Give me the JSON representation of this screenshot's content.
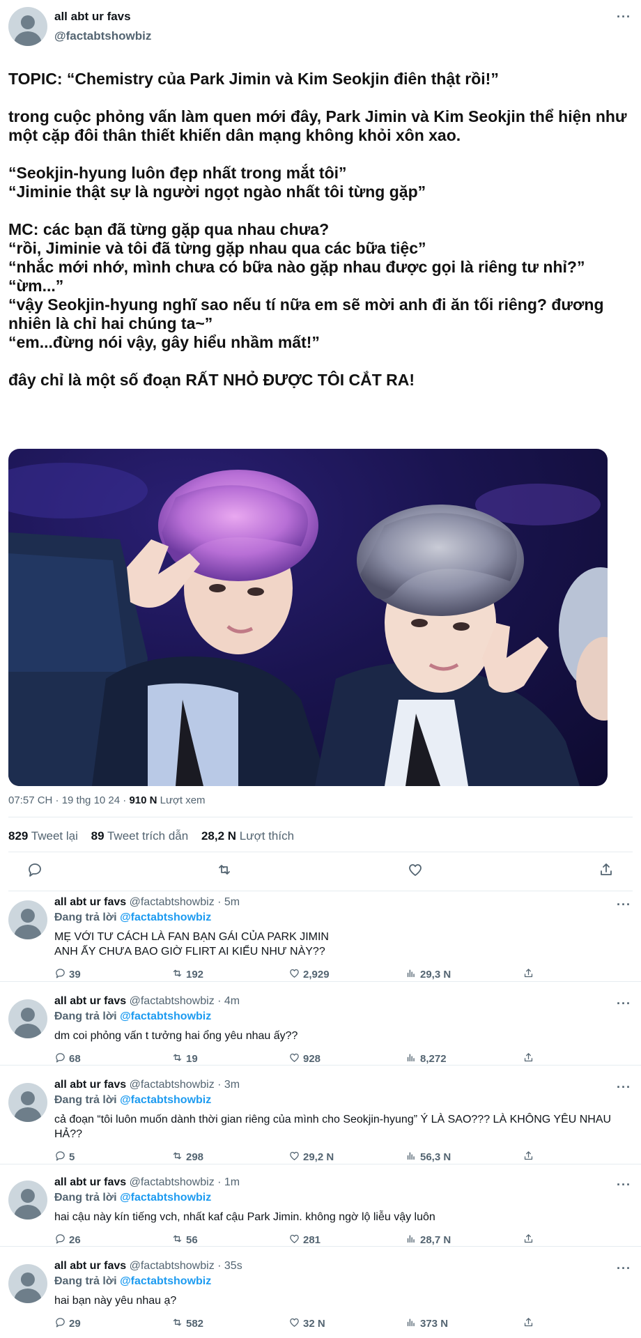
{
  "main": {
    "name": "all abt ur favs",
    "handle": "@factabtshowbiz",
    "more": "···",
    "text": "TOPIC: “Chemistry của Park Jimin và Kim Seokjin điên thật rồi!”\n\ntrong cuộc phỏng vấn làm quen mới đây, Park Jimin và Kim Seokjin thể hiện như một cặp đôi thân thiết khiến dân mạng không khỏi xôn xao.\n\n“Seokjin-hyung luôn đẹp nhất trong mắt tôi”\n“Jiminie thật sự là người ngọt ngào nhất tôi từng gặp”\n\nMC: các bạn đã từng gặp qua nhau chưa?\n“rồi, Jiminie và tôi đã từng gặp nhau qua các bữa tiệc”\n“nhắc mới nhớ, mình chưa có bữa nào gặp nhau được gọi là riêng tư nhỉ?”\n“ừm...”\n“vậy Seokjin-hyung nghĩ sao nếu tí nữa em sẽ mời anh đi ăn tối riêng? đương nhiên là chỉ hai chúng ta~”\n“em...đừng nói vậy, gây hiểu nhầm mất!”\n\nđây chỉ là một số đoạn RẤT NHỎ ĐƯỢC TÔI CẮT RA!",
    "time": "07:57 CH · 19 thg 10 24 ·",
    "views_num": "910 N",
    "views_label": "Lượt xem",
    "retweets_num": "829",
    "retweets_label": "Tweet lại",
    "quotes_num": "89",
    "quotes_label": "Tweet trích dẫn",
    "likes_num": "28,2 N",
    "likes_label": "Lượt thích"
  },
  "replies": [
    {
      "name": "all abt ur favs",
      "handle": "@factabtshowbiz · 5m",
      "replying": "Đang trả lời",
      "mention": "@factabtshowbiz",
      "text": "MẸ VỚI TƯ CÁCH LÀ FAN BẠN GÁI CỦA PARK JIMIN\nANH ẤY CHƯA BAO GIỜ FLIRT AI KIỂU NHƯ NÀY??",
      "comments": "39",
      "retweets": "192",
      "likes": "2,929",
      "views": "29,3 N"
    },
    {
      "name": "all abt ur favs",
      "handle": "@factabtshowbiz · 4m",
      "replying": "Đang trả lời",
      "mention": "@factabtshowbiz",
      "text": "dm coi phỏng vấn t tưởng hai ổng yêu nhau ấy??",
      "comments": "68",
      "retweets": "19",
      "likes": "928",
      "views": "8,272"
    },
    {
      "name": "all abt ur favs",
      "handle": "@factabtshowbiz · 3m",
      "replying": "Đang trả lời",
      "mention": "@factabtshowbiz",
      "text": "cả đoạn “tôi luôn muốn dành thời gian riêng của mình cho Seokjin-hyung” Ý LÀ SAO??? LÀ KHÔNG YÊU NHAU HẢ??",
      "comments": "5",
      "retweets": "298",
      "likes": "29,2 N",
      "views": "56,3 N"
    },
    {
      "name": "all abt ur favs",
      "handle": "@factabtshowbiz · 1m",
      "replying": "Đang trả lời",
      "mention": "@factabtshowbiz",
      "text": "hai cậu này kín tiếng vch, nhất kaf cậu Park Jimin. không ngờ lộ liễu vậy luôn",
      "comments": "26",
      "retweets": "56",
      "likes": "281",
      "views": "28,7 N"
    },
    {
      "name": "all abt ur favs",
      "handle": "@factabtshowbiz · 35s",
      "replying": "Đang trả lời",
      "mention": "@factabtshowbiz",
      "text": "hai bạn này yêu nhau ạ?",
      "comments": "29",
      "retweets": "582",
      "likes": "32 N",
      "views": "373 N"
    }
  ]
}
